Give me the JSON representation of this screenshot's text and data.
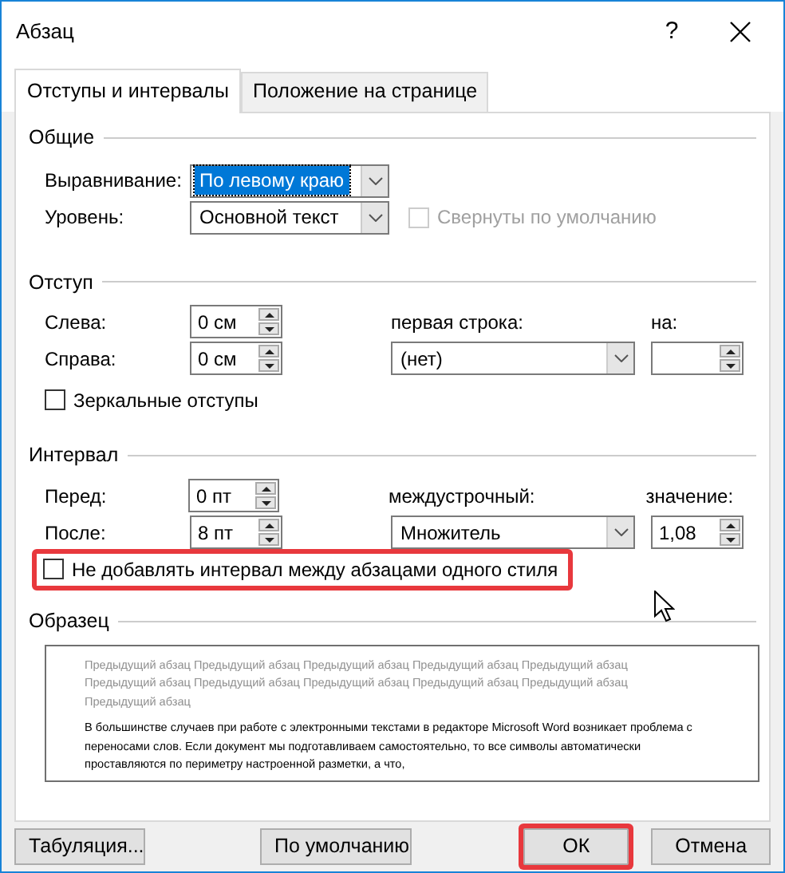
{
  "window": {
    "title": "Абзац",
    "help": "?"
  },
  "tabs": [
    {
      "label": "Отступы и интервалы",
      "selected": true
    },
    {
      "label": "Положение на странице",
      "selected": false
    }
  ],
  "general": {
    "heading": "Общие",
    "alignment": {
      "label": "Выравнивание:",
      "value": "По левому краю",
      "focused": true
    },
    "level": {
      "label": "Уровень:",
      "value": "Основной текст",
      "focused": false
    },
    "collapsed": {
      "label": "Свернуты по умолчанию",
      "checked": false,
      "disabled": true
    }
  },
  "indent": {
    "heading": "Отступ",
    "left": {
      "label": "Слева:",
      "value": "0 см"
    },
    "right": {
      "label": "Справа:",
      "value": "0 см"
    },
    "first_line": {
      "label": "первая строка:",
      "value": "(нет)"
    },
    "by": {
      "label": "на:"
    },
    "mirror": {
      "label": "Зеркальные отступы",
      "checked": false,
      "disabled": false
    }
  },
  "spacing": {
    "heading": "Интервал",
    "before": {
      "label": "Перед:",
      "value": "0 пт"
    },
    "after": {
      "label": "После:",
      "value": "8 пт"
    },
    "line_spacing": {
      "label": "междустрочный:",
      "value": "Множитель"
    },
    "at": {
      "label": "значение:",
      "value": "1,08"
    },
    "dont_add": {
      "label": "Не добавлять интервал между абзацами одного стиля",
      "checked": false,
      "disabled": false,
      "highlighted": true
    }
  },
  "preview": {
    "heading": "Образец",
    "previous": "Предыдущий абзац Предыдущий абзац Предыдущий абзац Предыдущий абзац Предыдущий абзац Предыдущий абзац Предыдущий абзац Предыдущий абзац Предыдущий абзац Предыдущий абзац Предыдущий абзац",
    "sample": "В большинстве случаев при работе с электронными текстами в редакторе Microsoft Word возникает проблема с переносами слов. Если документ мы подготавливаем самостоятельно, то все символы автоматически проставляются по периметру настроенной разметки, а что,"
  },
  "buttons": [
    {
      "label": "Табуляция...",
      "highlighted": false
    },
    {
      "label": "По умолчанию",
      "highlighted": false
    },
    {
      "label": "ОК",
      "highlighted": true
    },
    {
      "label": "Отмена",
      "highlighted": false
    }
  ]
}
